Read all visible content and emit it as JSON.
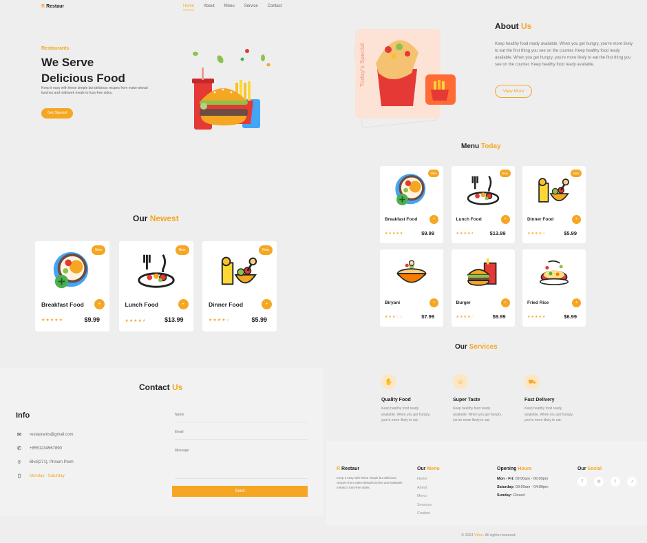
{
  "header": {
    "brand_logo": "R",
    "brand_name": "Restaur",
    "nav": [
      "Home",
      "About",
      "Menu",
      "Service",
      "Contact"
    ]
  },
  "hero": {
    "kicker": "Restaurants",
    "title_line1": "We Serve",
    "title_line2": "Delicious Food",
    "description": "Keep it easy with these simple but delicious recipes from make-ahead lunches and midweek meals to fuss-free sides.",
    "button": "Get Started"
  },
  "about": {
    "title_prefix": "About",
    "title_highlight": "Us",
    "special_label": "Today's Special",
    "text": "Keep healthy food ready available. When you get hungry, you're more likely to eat the first thing you see on the counter. Keep healthy food ready available. When you get hungry, you're more likely to eat the first thing you see on the counter. Keep healthy food ready available.",
    "button": "View More"
  },
  "newest": {
    "title_prefix": "Our",
    "title_highlight": "Newest",
    "items": [
      {
        "name": "Breakfast Food",
        "price": "$9.99",
        "badge": "New",
        "stars": "★★★★★"
      },
      {
        "name": "Lunch Food",
        "price": "$13.99",
        "badge": "New",
        "stars": "★★★★⯨"
      },
      {
        "name": "Dinner Food",
        "price": "$5.99",
        "badge": "New",
        "stars": "★★★★☆"
      }
    ]
  },
  "menu": {
    "title_prefix": "Menu",
    "title_highlight": "Today",
    "items": [
      {
        "name": "Breakfast Food",
        "price": "$9.99",
        "badge": "New",
        "stars": "★★★★★"
      },
      {
        "name": "Lunch Food",
        "price": "$13.99",
        "badge": "New",
        "stars": "★★★★⯨"
      },
      {
        "name": "Dinner Food",
        "price": "$5.99",
        "badge": "New",
        "stars": "★★★★☆"
      },
      {
        "name": "Biryani",
        "price": "$7.99",
        "badge": "",
        "stars": "★★★☆☆"
      },
      {
        "name": "Burger",
        "price": "$9.99",
        "badge": "",
        "stars": "★★★★☆"
      },
      {
        "name": "Fried Rice",
        "price": "$6.99",
        "badge": "",
        "stars": "★★★★★"
      }
    ]
  },
  "services": {
    "title_prefix": "Our",
    "title_highlight": "Services",
    "items": [
      {
        "title": "Quality Food",
        "text": "Keep healthy food ready available. When you get hungry, you're more likely to eat."
      },
      {
        "title": "Super Taste",
        "text": "Keep healthy food ready available. When you get hungry, you're more likely to eat."
      },
      {
        "title": "Fast Delivery",
        "text": "Keep healthy food ready available. When you get hungry, you're more likely to eat."
      }
    ]
  },
  "contact": {
    "title_prefix": "Contact",
    "title_highlight": "Us",
    "info_title": "Info",
    "email": "restaurants@gmail.com",
    "phone": "+8551234567890",
    "address": "Blvd(271), Phnom Penh",
    "days": "Monday - Saturday",
    "name_label": "Name",
    "email_label": "Email",
    "message_label": "Message",
    "send": "Send"
  },
  "footer": {
    "brand_logo": "R",
    "brand_name": "Restaur",
    "description": "Keep it easy with these simple but delicious recipes from make-ahead lunches and midweek meals to fuss-free sides.",
    "menu_title_prefix": "Our",
    "menu_title_highlight": "Menu",
    "menu_links": [
      "Home",
      "About",
      "Menu",
      "Services",
      "Contact"
    ],
    "hours_title_prefix": "Opening",
    "hours_title_highlight": "Hours",
    "hours_weekday_label": "Mon - Fri:",
    "hours_weekday": "09:00am - 06:00pm",
    "hours_saturday_label": "Saturday:",
    "hours_saturday": "09:00am - 04:00pm",
    "hours_sunday_label": "Sunday:",
    "hours_sunday": "Closed",
    "social_title_prefix": "Our",
    "social_title_highlight": "Social",
    "social_icons": [
      "f",
      "◎",
      "t",
      "♪"
    ],
    "copyright_prefix": "© 2024",
    "copyright_brand": "Vitou.",
    "copyright_suffix": "All rights reserved."
  },
  "colors": {
    "accent": "#f5a623",
    "background": "#eeeeee",
    "card": "#ffffff"
  }
}
